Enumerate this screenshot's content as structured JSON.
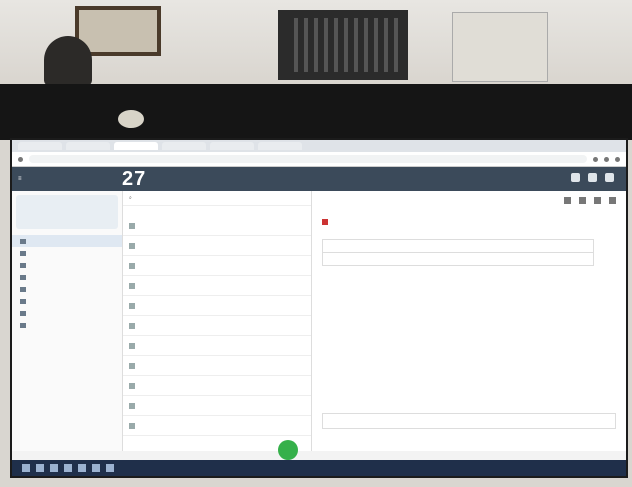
{
  "browser": {
    "tabs": [
      "",
      "",
      "",
      "",
      "",
      ""
    ],
    "url": ""
  },
  "app": {
    "date_small_1": "",
    "date_small_2": "",
    "date_big": "27"
  },
  "sidebar": {
    "account": "",
    "folders": []
  },
  "maillist": {
    "search_placeholder": "",
    "items": []
  },
  "reader": {
    "sender_name": "",
    "sender_addr": "",
    "subject": "",
    "body_1": "",
    "body_2": "",
    "table": {
      "headers": [
        "",
        "",
        ""
      ],
      "row": [
        "",
        "",
        ""
      ]
    },
    "footer_text": "",
    "reply_placeholder": ""
  },
  "colors": {
    "app_header": "#3b4a5a",
    "fab": "#35b04a",
    "taskbar": "#1f2f4a"
  }
}
